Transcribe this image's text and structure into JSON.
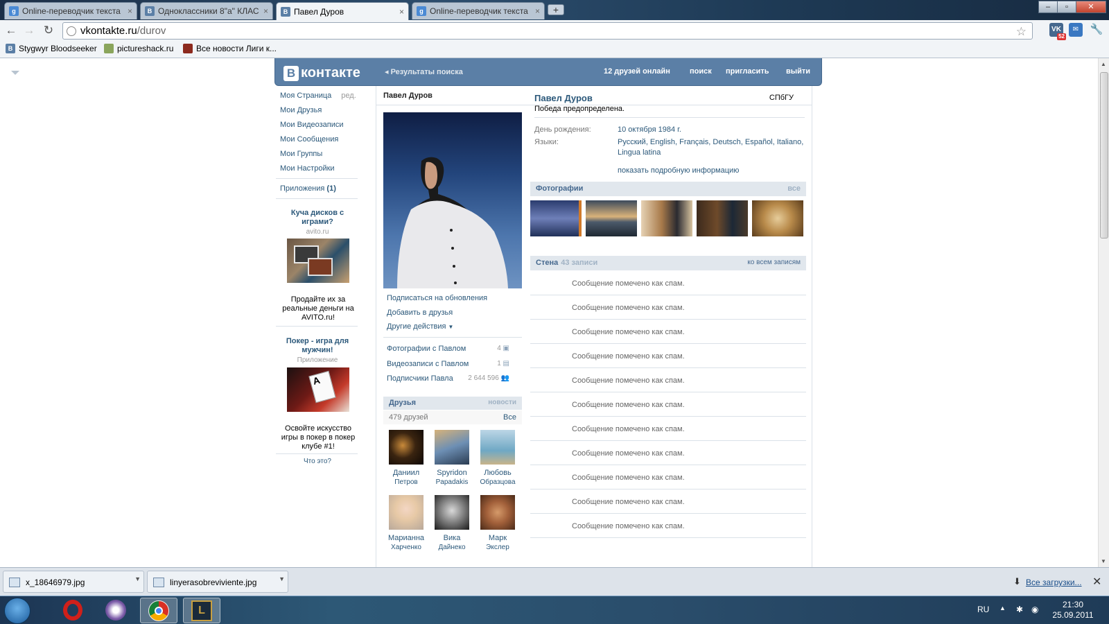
{
  "browser": {
    "tabs": [
      {
        "label": "Online-переводчик текста",
        "icon": "google-translate-icon",
        "active": false
      },
      {
        "label": "Одноклассники 8\"а\" КЛАС",
        "icon": "vk-icon",
        "active": false
      },
      {
        "label": "Павел Дуров",
        "icon": "vk-icon",
        "active": true
      },
      {
        "label": "Online-переводчик текста",
        "icon": "google-translate-icon",
        "active": false
      }
    ],
    "address": {
      "host": "vkontakte.ru",
      "path": "/durov"
    },
    "ext_vk_badge": "52",
    "bookmarks": [
      "Stygwyr Bloodseeker",
      "pictureshack.ru",
      "Все новости Лиги к..."
    ]
  },
  "vk": {
    "logo": "контакте",
    "logo_letter": "В",
    "header": {
      "back": "Результаты поиска",
      "friends_online": "12 друзей онлайн",
      "search": "поиск",
      "invite": "пригласить",
      "logout": "выйти"
    },
    "left_menu": {
      "my_page": "Моя Страница",
      "edit": "ред.",
      "items": [
        "Мои Друзья",
        "Мои Видеозаписи",
        "Мои Сообщения",
        "Мои Группы",
        "Мои Настройки"
      ],
      "apps": "Приложения",
      "apps_count": "(1)"
    },
    "ads": [
      {
        "title": "Куча дисков с играми?",
        "sub": "avito.ru",
        "text": "Продайте их за реальные деньги на AVITO.ru!"
      },
      {
        "title": "Покер - игра для мужчин!",
        "sub": "Приложение",
        "text": "Освойте искусство игры в покер в покер клубе #1!"
      }
    ],
    "ads_what": "Что это?",
    "profile": {
      "page_title": "Павел Дуров",
      "name": "Павел Дуров",
      "university": "СПбГУ",
      "status": "Победа предопределена.",
      "birthday_label": "День рождения:",
      "birthday": "10 октября 1984 г.",
      "languages_label": "Языки:",
      "languages": "Русский, English, Français, Deutsch, Español, Italiano, Lingua latina",
      "show_more": "показать подробную информацию"
    },
    "actions": {
      "subscribe": "Подписаться на обновления",
      "add_friend": "Добавить в друзья",
      "other": "Другие действия"
    },
    "counters": [
      {
        "label": "Фотографии с Павлом",
        "count": "4",
        "icon": "camera-icon"
      },
      {
        "label": "Видеозаписи с Павлом",
        "count": "1",
        "icon": "film-icon"
      },
      {
        "label": "Подписчики Павла",
        "count": "2 644 596",
        "icon": "people-icon"
      }
    ],
    "friends": {
      "title": "Друзья",
      "news": "новости",
      "count": "479 друзей",
      "all": "Все",
      "list": [
        {
          "first": "Даниил",
          "last": "Петров"
        },
        {
          "first": "Spyridon",
          "last": "Papadakis"
        },
        {
          "first": "Любовь",
          "last": "Образцова"
        },
        {
          "first": "Марианна",
          "last": "Харченко"
        },
        {
          "first": "Вика",
          "last": "Дайнеко"
        },
        {
          "first": "Марк",
          "last": "Экслер"
        }
      ]
    },
    "photos": {
      "title": "Фотографии",
      "all": "все"
    },
    "wall": {
      "title": "Стена",
      "count": "43 записи",
      "all": "ко всем записям",
      "posts": [
        "Сообщение помечено как спам.",
        "Сообщение помечено как спам.",
        "Сообщение помечено как спам.",
        "Сообщение помечено как спам.",
        "Сообщение помечено как спам.",
        "Сообщение помечено как спам.",
        "Сообщение помечено как спам.",
        "Сообщение помечено как спам.",
        "Сообщение помечено как спам.",
        "Сообщение помечено как спам.",
        "Сообщение помечено как спам."
      ]
    }
  },
  "downloads": {
    "items": [
      "x_18646979.jpg",
      "linyerasobreviviente.jpg"
    ],
    "all": "Все загрузки..."
  },
  "taskbar": {
    "lang": "RU",
    "time": "21:30",
    "date": "25.09.2011"
  }
}
